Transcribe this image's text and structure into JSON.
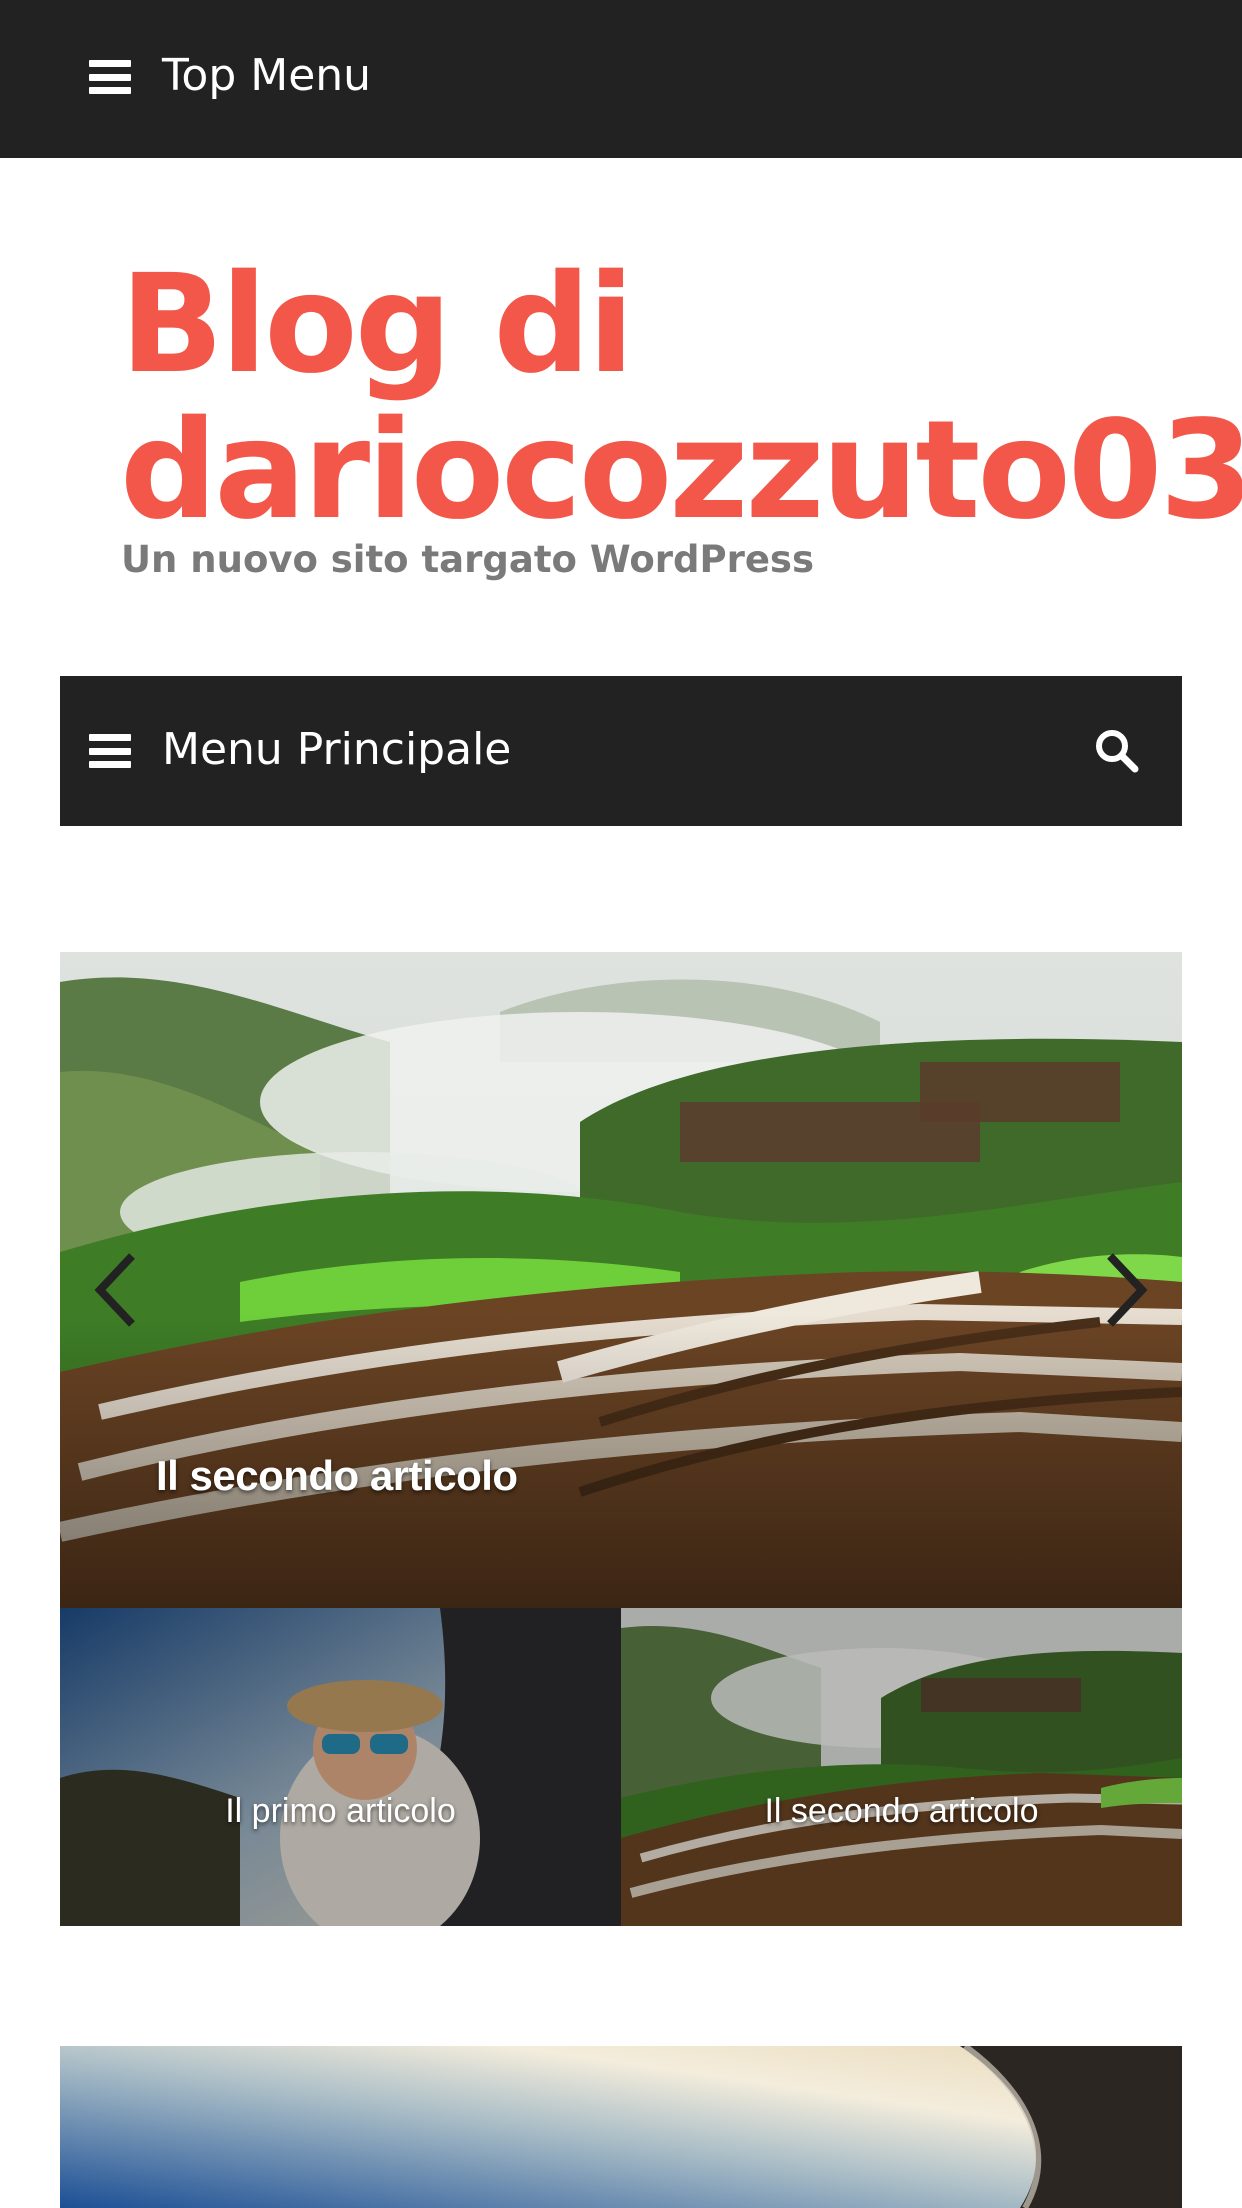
{
  "top_menu": {
    "label": "Top Menu",
    "icon": "menu-icon"
  },
  "site": {
    "title_line1": "Blog di",
    "title_line2": "dariocozzuto03",
    "description": "Un nuovo sito targato WordPress",
    "title_color": "#f2574a"
  },
  "main_menu": {
    "label": "Menu Principale",
    "icon": "menu-icon",
    "search_icon": "search-icon"
  },
  "slider": {
    "current_caption": "Il secondo articolo",
    "prev_icon": "chevron-left-icon",
    "next_icon": "chevron-right-icon"
  },
  "thumbnails": [
    {
      "label": "Il primo articolo"
    },
    {
      "label": "Il secondo articolo"
    }
  ],
  "colors": {
    "bar_bg": "#222222",
    "accent": "#f2574a",
    "muted": "#7a7a7a"
  }
}
